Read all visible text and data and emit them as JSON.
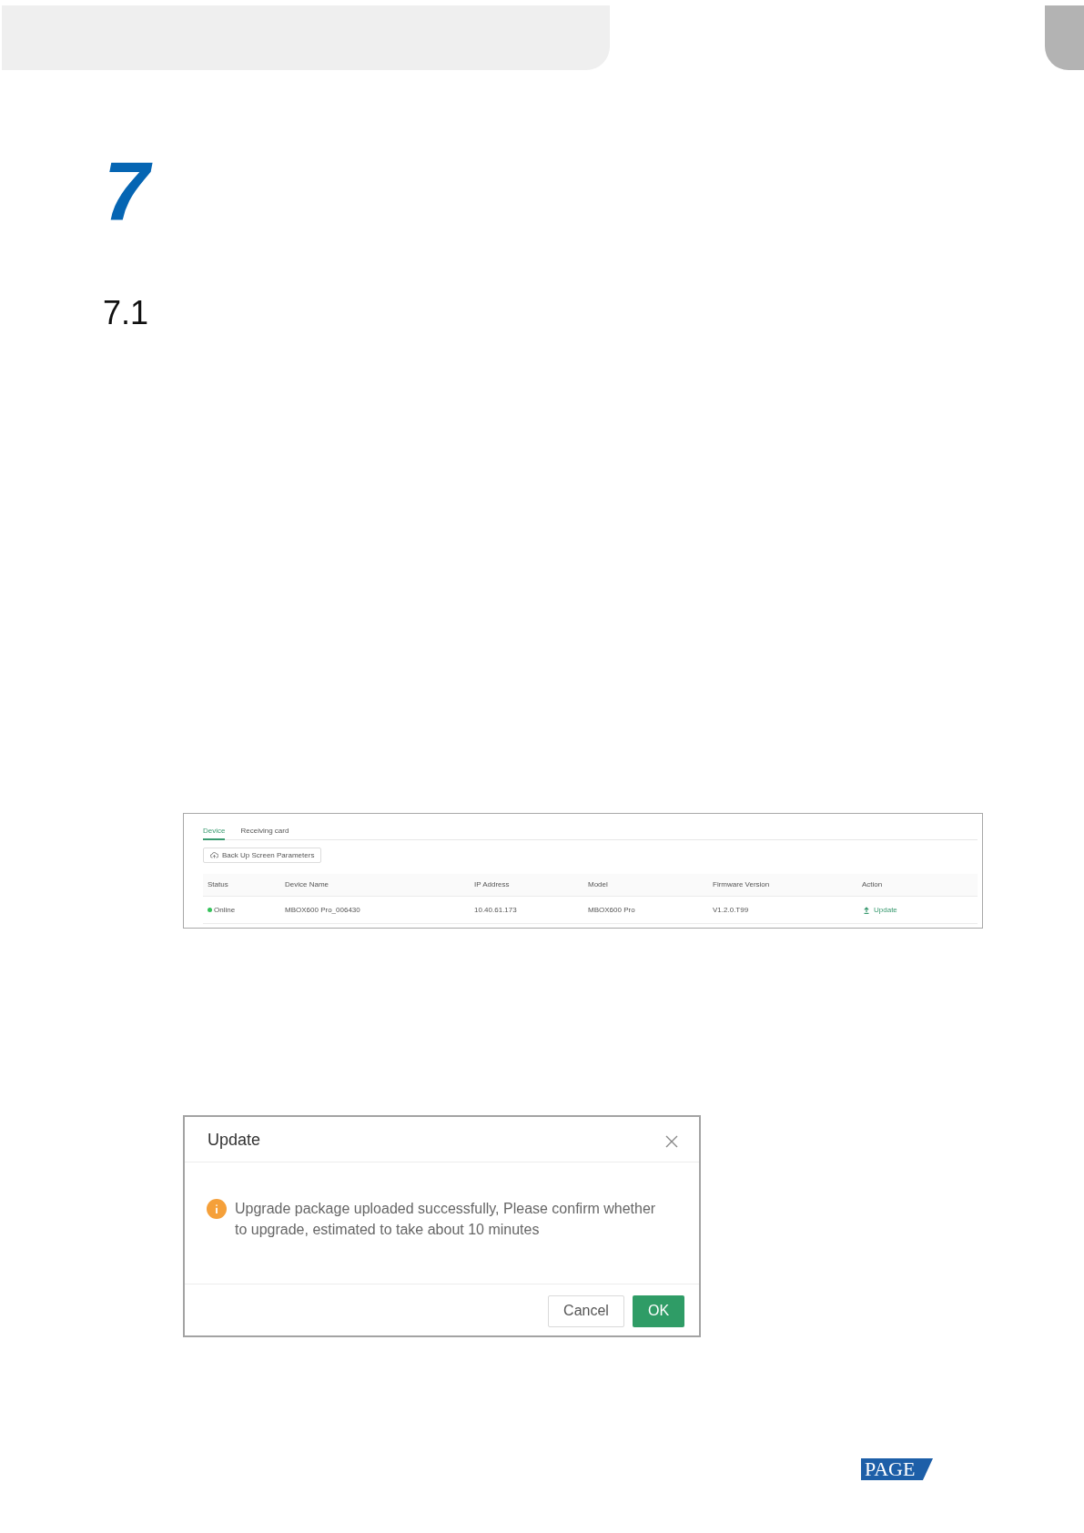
{
  "chapter": {
    "number": "7"
  },
  "section": {
    "number": "7.1"
  },
  "device_panel": {
    "tabs": [
      {
        "label": "Device",
        "selected": true
      },
      {
        "label": "Receiving card",
        "selected": false
      }
    ],
    "backup_button": {
      "label": "Back Up Screen Parameters"
    },
    "table": {
      "columns": [
        "Status",
        "Device Name",
        "IP Address",
        "Model",
        "Firmware Version",
        "Action"
      ],
      "rows": [
        {
          "cells": [
            {
              "kind": "status",
              "text": "Online",
              "color": "#35c25a"
            },
            {
              "kind": "text",
              "text": "MBOX600 Pro_006430"
            },
            {
              "kind": "text",
              "text": "10.40.61.173"
            },
            {
              "kind": "text",
              "text": "MBOX600 Pro"
            },
            {
              "kind": "text",
              "text": "V1.2.0.T99"
            },
            {
              "kind": "action",
              "text": "Update"
            }
          ]
        }
      ]
    }
  },
  "dialog": {
    "title": "Update",
    "message": "Upgrade package uploaded successfully, Please confirm whether to upgrade, estimated to take about 10 minutes",
    "buttons": [
      {
        "label": "Cancel",
        "kind": "default"
      },
      {
        "label": "OK",
        "kind": "primary"
      }
    ]
  },
  "footer": {
    "logo": "PAGE"
  }
}
